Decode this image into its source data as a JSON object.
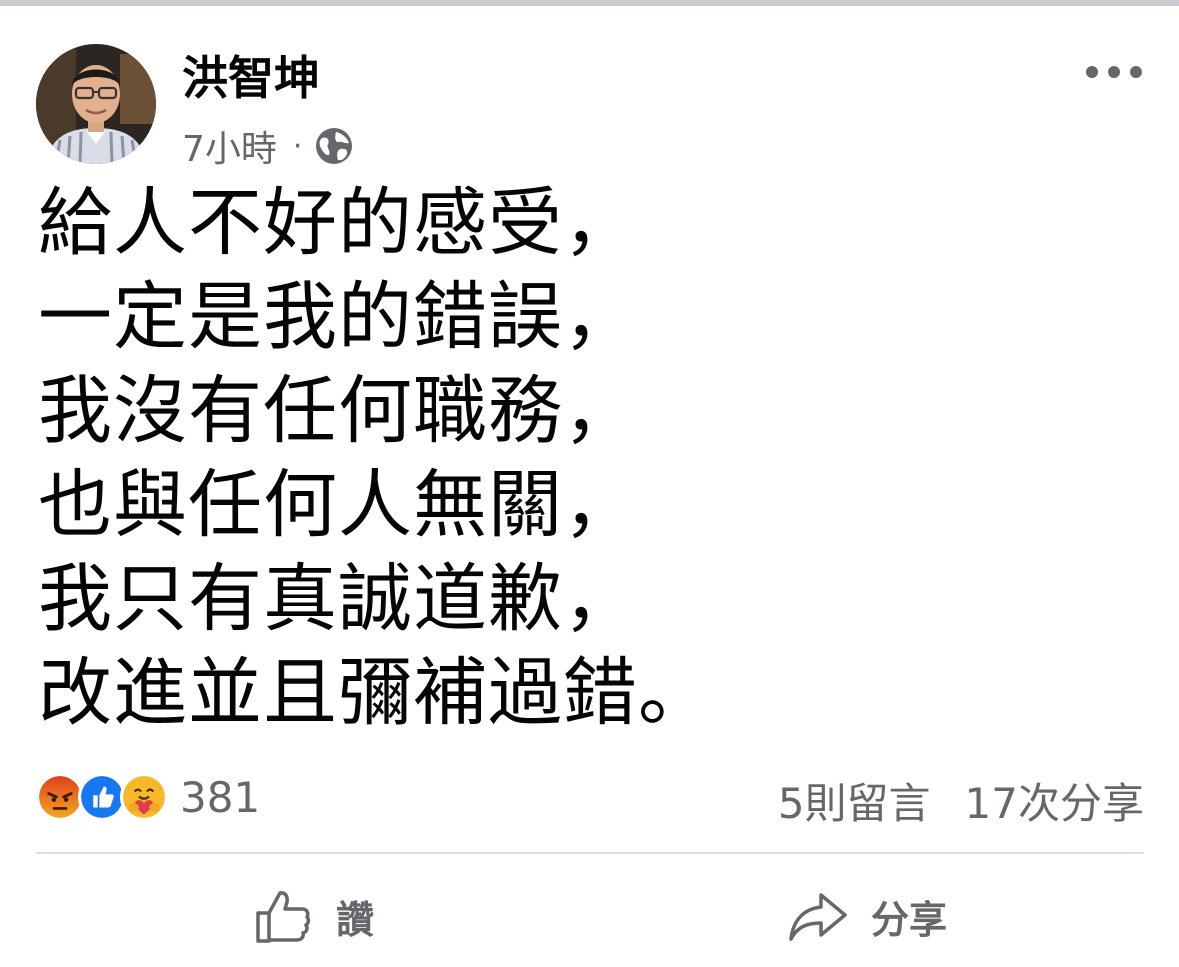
{
  "post": {
    "author": "洪智坤",
    "time": "7小時",
    "separator": "·",
    "privacy_icon": "globe-icon",
    "more_icon": "more-options-icon",
    "content_lines": [
      "給人不好的感受，",
      "一定是我的錯誤，",
      "我沒有任何職務，",
      "也與任何人無關，",
      "我只有真誠道歉，",
      "改進並且彌補過錯。"
    ]
  },
  "stats": {
    "reactions": [
      "angry-reaction-icon",
      "like-reaction-icon",
      "care-reaction-icon"
    ],
    "reaction_count": "381",
    "comments": "5則留言",
    "shares": "17次分享"
  },
  "actions": {
    "like_label": "讚",
    "like_icon": "thumbs-up-icon",
    "share_label": "分享",
    "share_icon": "share-arrow-icon"
  },
  "colors": {
    "text_primary": "#050505",
    "text_secondary": "#65676b",
    "divider": "#dadde1",
    "like_blue": "#1877f2",
    "angry_orange": "#e9710f",
    "care_yellow": "#f7b928"
  }
}
